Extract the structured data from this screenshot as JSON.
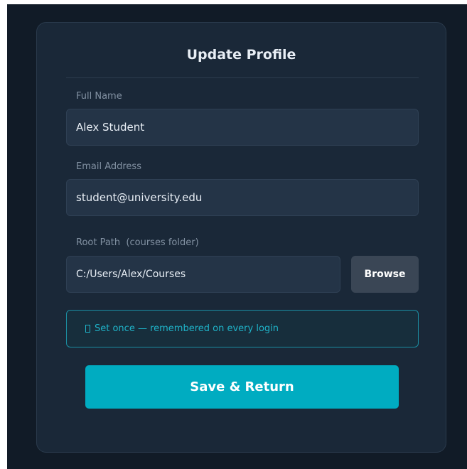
{
  "form": {
    "title": "Update Profile",
    "full_name": {
      "label": "Full Name",
      "value": "Alex Student"
    },
    "email": {
      "label": "Email Address",
      "value": "student@university.edu"
    },
    "root_path": {
      "label": "Root Path  (courses folder)",
      "value": "C:/Users/Alex/Courses",
      "browse_label": "Browse"
    },
    "hint": {
      "icon": "info-icon",
      "text": "Set once — remembered on every login"
    },
    "save_label": "Save & Return"
  },
  "colors": {
    "background": "#111b27",
    "card": "#1a2838",
    "field": "#243447",
    "accent": "#00acc1",
    "hint_text": "#1fb3c8",
    "browse_button": "#3a4655"
  }
}
